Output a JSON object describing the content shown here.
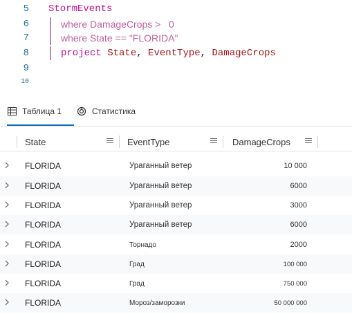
{
  "editor": {
    "lines": [
      {
        "num": "5",
        "text": "StormEvents"
      },
      {
        "num": "6",
        "text": "where DamageCrops >   0"
      },
      {
        "num": "7",
        "text": "where State == \"FLORIDA\""
      },
      {
        "num": "8",
        "keyword": "project",
        "ident1": "State",
        "sep1": ",",
        "ident2": "EventType",
        "sep2": ",",
        "ident3": "DamageCrops"
      },
      {
        "num": "9",
        "text": ""
      },
      {
        "num": "10",
        "text": ""
      }
    ]
  },
  "tabs": [
    {
      "label": "Таблица 1",
      "icon": "table-icon",
      "active": true
    },
    {
      "label": "Статистика",
      "icon": "stats-icon",
      "active": false
    }
  ],
  "table": {
    "columns": [
      "State",
      "EventType",
      "DamageCrops"
    ],
    "rows": [
      {
        "state": "FLORIDA",
        "event": "Ураганный ветер",
        "damage": "10 000"
      },
      {
        "state": "FLORIDA",
        "event": "Ураганный ветер",
        "damage": "6000"
      },
      {
        "state": "FLORIDA",
        "event": "Ураганный ветер",
        "damage": "3000"
      },
      {
        "state": "FLORIDA",
        "event": "Ураганный ветер",
        "damage": "6000"
      },
      {
        "state": "FLORIDA",
        "event": "Торнадо",
        "damage": "2000"
      },
      {
        "state": "FLORIDA",
        "event": "Град",
        "damage": "100 000"
      },
      {
        "state": "FLORIDA",
        "event": "Град",
        "damage": "750 000"
      },
      {
        "state": "FLORIDA",
        "event": "Мороз/заморозки",
        "damage": "50 000 000"
      }
    ]
  }
}
